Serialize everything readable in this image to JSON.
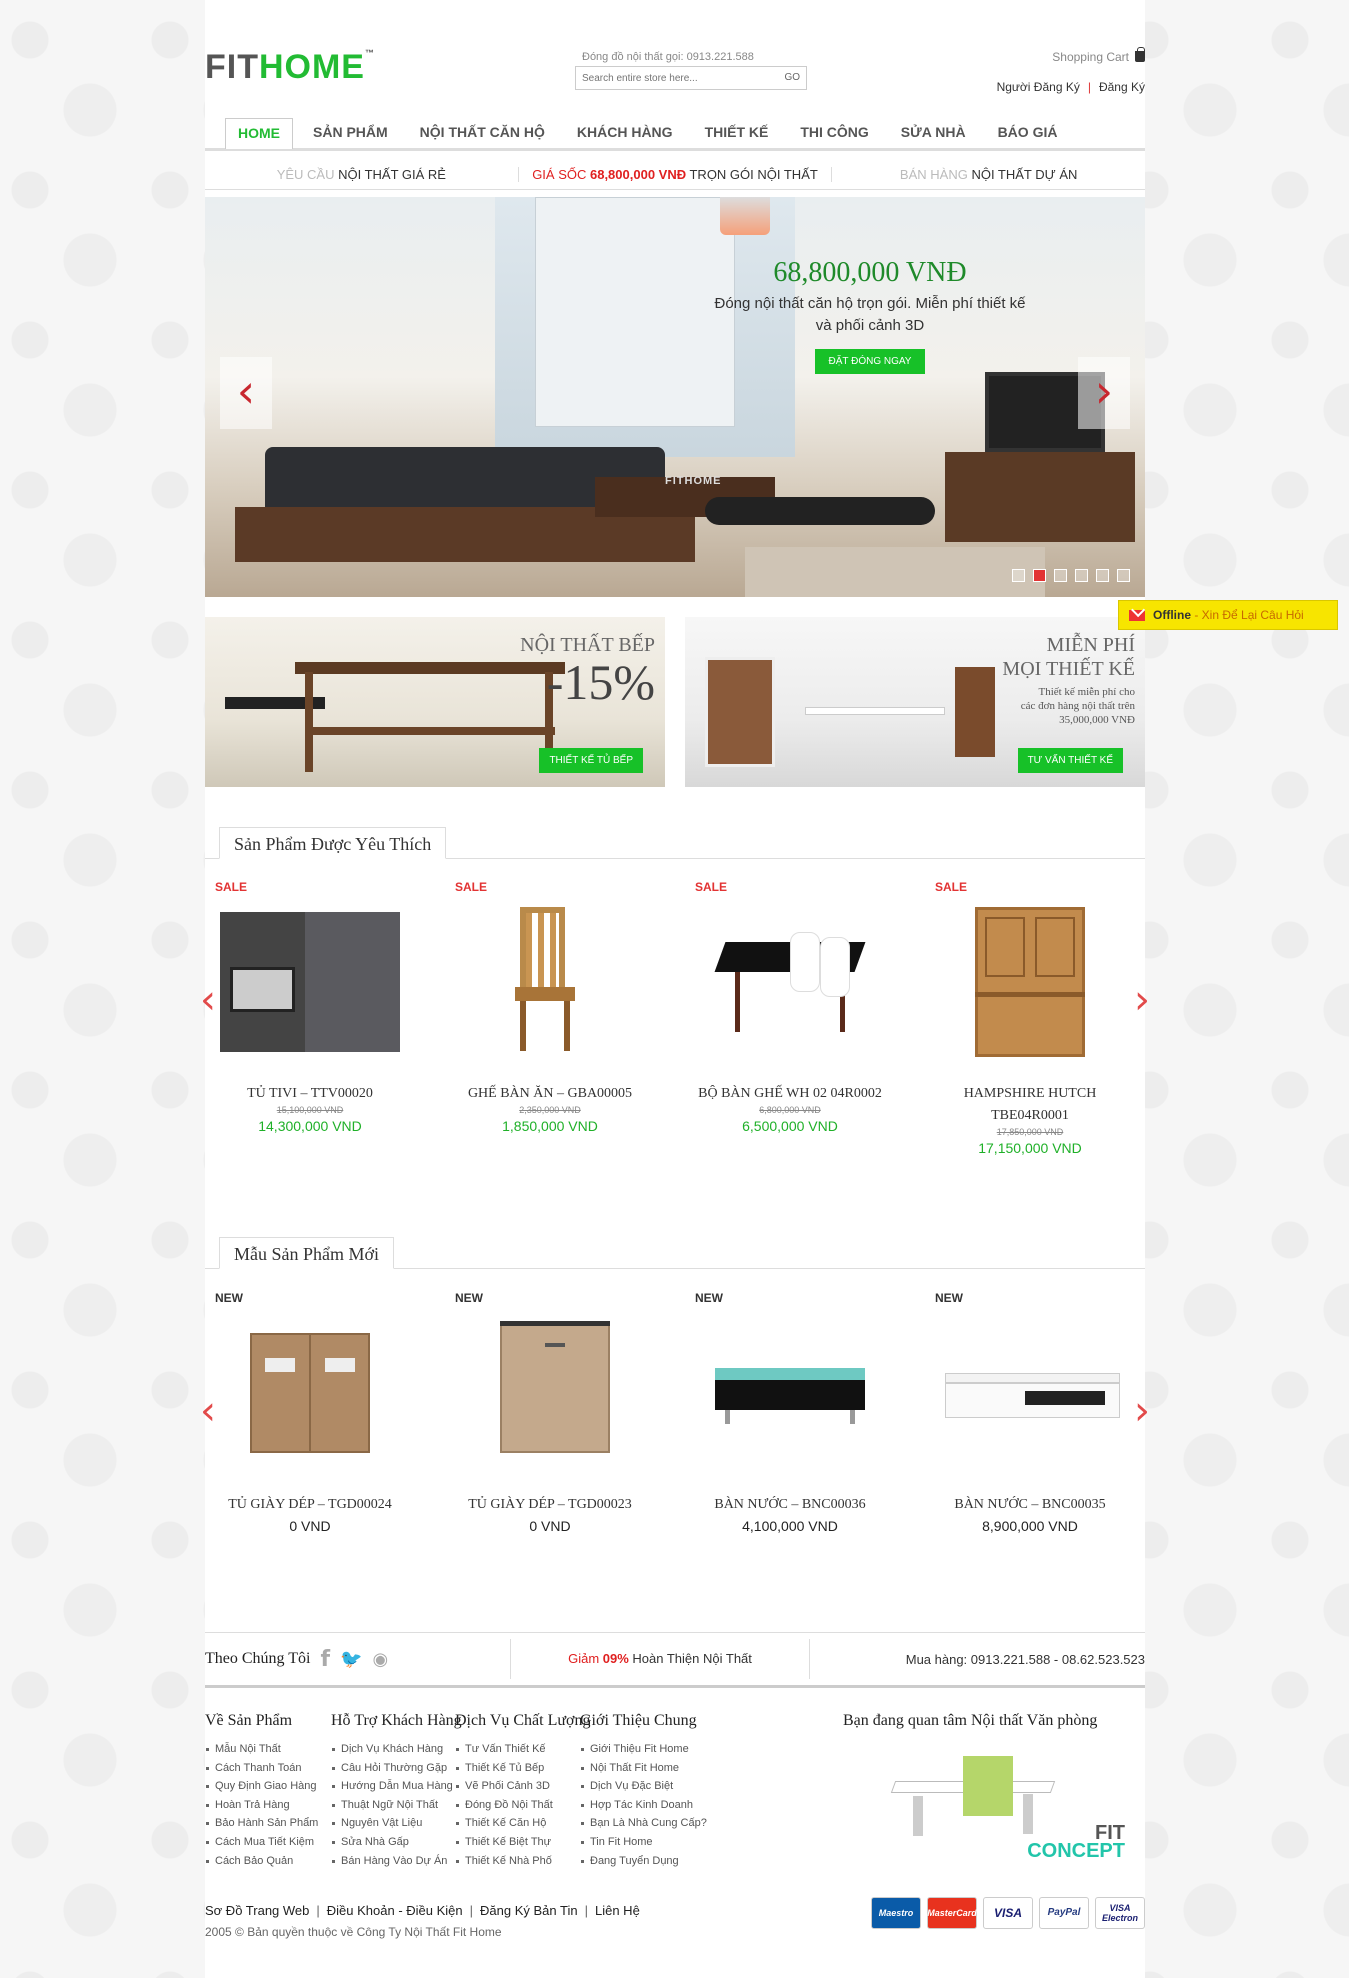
{
  "header": {
    "logo_part1": "FIT",
    "logo_part2": "HOME",
    "logo_tm": "™",
    "hotline": "Đóng đồ nội thất gọi: 0913.221.588",
    "search_placeholder": "Search entire store here...",
    "search_button": "GO",
    "cart_label": "Shopping Cart",
    "login_label": "Người Đăng Ký",
    "register_label": "Đăng Ký"
  },
  "nav": [
    {
      "label": "HOME",
      "active": true
    },
    {
      "label": "SẢN PHẨM"
    },
    {
      "label": "NỘI THẤT CĂN HỘ"
    },
    {
      "label": "KHÁCH HÀNG"
    },
    {
      "label": "THIẾT KẾ"
    },
    {
      "label": "THI CÔNG"
    },
    {
      "label": "SỬA NHÀ"
    },
    {
      "label": "BÁO GIÁ"
    }
  ],
  "promo_bar": [
    {
      "muted": "YÊU CẦU",
      "text": " NỘI THẤT GIÁ RẺ"
    },
    {
      "red": "GIÁ SỐC ",
      "bold_red": "68,800,000 VNĐ",
      "text": " TRỌN GÓI NỘI THẤT"
    },
    {
      "muted": "BÁN HÀNG",
      "text": " NỘI THẤT DỰ ÁN"
    }
  ],
  "hero": {
    "price": "68,800,000 VNĐ",
    "subtitle_line1": "Đóng nội thất căn hộ trọn gói. Miễn phí thiết kế",
    "subtitle_line2": "và phối cảnh 3D",
    "cta": "ĐẶT ĐÓNG NGAY",
    "watermark": "FITHOME",
    "slide_count": 6,
    "active_slide": 2
  },
  "banners": {
    "kitchen": {
      "title": "NỘI THẤT BẾP",
      "discount": "-15%",
      "cta": "THIẾT KẾ TỦ BẾP"
    },
    "design": {
      "title1": "MIỄN PHÍ",
      "title2": "MỌI THIẾT KẾ",
      "desc1": "Thiết kế miễn phí cho",
      "desc2": "các đơn hàng nội thất trên",
      "desc3": "35,000,000 VNĐ",
      "cta": "TƯ VẤN THIẾT KẾ"
    }
  },
  "favorites": {
    "title": "Sản Phẩm Được Yêu Thích",
    "items": [
      {
        "tag": "SALE",
        "name": "TỦ TIVI – TTV00020",
        "old_price": "15,100,000 VND",
        "price": "14,300,000 VND"
      },
      {
        "tag": "SALE",
        "name": "GHẾ BÀN ĂN – GBA00005",
        "old_price": "2,350,000 VND",
        "price": "1,850,000 VND"
      },
      {
        "tag": "SALE",
        "name": "BỘ BÀN GHẾ WH 02 04R0002",
        "old_price": "6,800,000 VND",
        "price": "6,500,000 VND"
      },
      {
        "tag": "SALE",
        "name_line1": "HAMPSHIRE HUTCH",
        "name_line2": "TBE04R0001",
        "old_price": "17,850,000 VND",
        "price": "17,150,000 VND"
      }
    ]
  },
  "new_products": {
    "title": "Mẫu Sản Phẩm Mới",
    "items": [
      {
        "tag": "NEW",
        "name": "TỦ GIÀY DÉP – TGD00024",
        "price": "0 VND"
      },
      {
        "tag": "NEW",
        "name": "TỦ GIÀY DÉP – TGD00023",
        "price": "0 VND"
      },
      {
        "tag": "NEW",
        "name": "BÀN NƯỚC – BNC00036",
        "price": "4,100,000 VND"
      },
      {
        "tag": "NEW",
        "name": "BÀN NƯỚC – BNC00035",
        "price": "8,900,000 VND"
      }
    ]
  },
  "follow": {
    "label": "Theo Chúng Tôi",
    "promo_red": "Giảm ",
    "promo_pct": "09%",
    "promo_text": " Hoàn Thiện Nội Thất",
    "phone": "Mua hàng: 0913.221.588 - 08.62.523.523"
  },
  "footer_columns": [
    {
      "title": "Về Sản Phẩm",
      "links": [
        "Mẫu Nội Thất",
        "Cách Thanh Toán",
        "Quy Định Giao Hàng",
        "Hoàn Trả Hàng",
        "Bảo Hành Sản Phẩm",
        "Cách Mua Tiết Kiệm",
        "Cách Bảo Quản"
      ]
    },
    {
      "title": "Hỗ Trợ Khách Hàng",
      "links": [
        "Dịch Vụ Khách Hàng",
        "Câu Hỏi Thường Gặp",
        "Hướng Dẫn Mua Hàng",
        "Thuật Ngữ Nội Thất",
        "Nguyên Vật Liệu",
        "Sửa Nhà Gấp",
        "Bán Hàng Vào Dự Án"
      ]
    },
    {
      "title": "Dịch Vụ Chất Lượng",
      "links": [
        "Tư Vấn Thiết Kế",
        "Thiết Kế Tủ Bếp",
        "Vẽ Phối Cảnh 3D",
        "Đóng Đồ Nội Thất",
        "Thiết Kế Căn Hộ",
        "Thiết Kế Biệt Thự",
        "Thiết Kế Nhà Phố"
      ]
    },
    {
      "title": "Giới Thiệu Chung",
      "links": [
        "Giới Thiệu Fit Home",
        "Nội Thất Fit Home",
        "Dịch Vụ Đặc Biệt",
        "Hợp Tác Kinh Doanh",
        "Bạn Là Nhà Cung Cấp?",
        "Tin Fit Home",
        "Đang Tuyển Dụng"
      ]
    }
  ],
  "office": {
    "title": "Bạn đang quan tâm Nội thất Văn phòng",
    "logo1": "FIT",
    "logo2": "CONCEPT"
  },
  "bottom_links": [
    "Sơ Đồ Trang Web",
    "Điều Khoản - Điều Kiện",
    "Đăng Ký Bản Tin",
    "Liên Hệ"
  ],
  "copyright": "2005 © Bản quyền thuộc về Công Ty Nội Thất Fit Home",
  "payment_cards": [
    "Maestro",
    "MasterCard",
    "VISA",
    "PayPal",
    "VISA Electron"
  ],
  "chat": {
    "status": "Offline",
    "text": " - Xin Để Lại Câu Hỏi"
  }
}
